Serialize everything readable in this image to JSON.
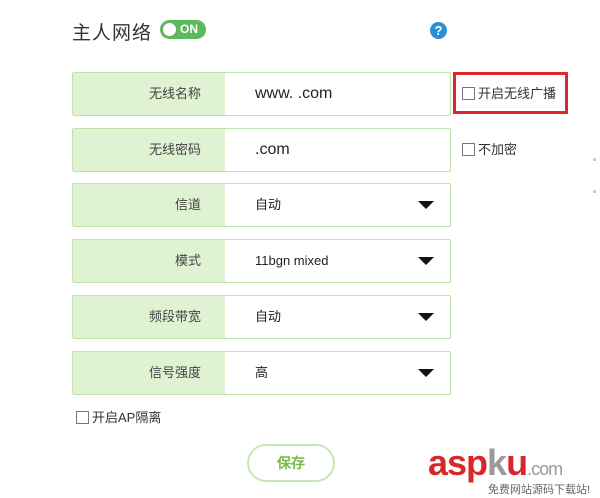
{
  "header": {
    "title": "主人网络",
    "toggle_label": "ON",
    "help_glyph": "?"
  },
  "fields": [
    {
      "label": "无线名称",
      "value": "www.       .com"
    },
    {
      "label": "无线密码",
      "value": "          .com"
    },
    {
      "label": "信道",
      "value": "自动"
    },
    {
      "label": "模式",
      "value": "11bgn mixed"
    },
    {
      "label": "频段带宽",
      "value": "自动"
    },
    {
      "label": "信号强度",
      "value": "高"
    }
  ],
  "options": {
    "broadcast_label": "开启无线广播",
    "broadcast_checked": false,
    "no_encrypt_label": "不加密",
    "no_encrypt_checked": false,
    "ap_isolation_label": "开启AP隔离",
    "ap_isolation_checked": false
  },
  "save_label": "保存",
  "watermark": {
    "asp": "asp",
    "k": "k",
    "u": "u",
    "com": ".com",
    "sub": "免费网站源码下载站!"
  },
  "colors": {
    "accent_green": "#5cb85c",
    "label_bg": "#dff2d2",
    "help_blue": "#2a8fd9",
    "highlight_red": "#e0262a"
  },
  "icons": {
    "help": "question-circle-icon",
    "dropdown": "caret-down-icon"
  }
}
